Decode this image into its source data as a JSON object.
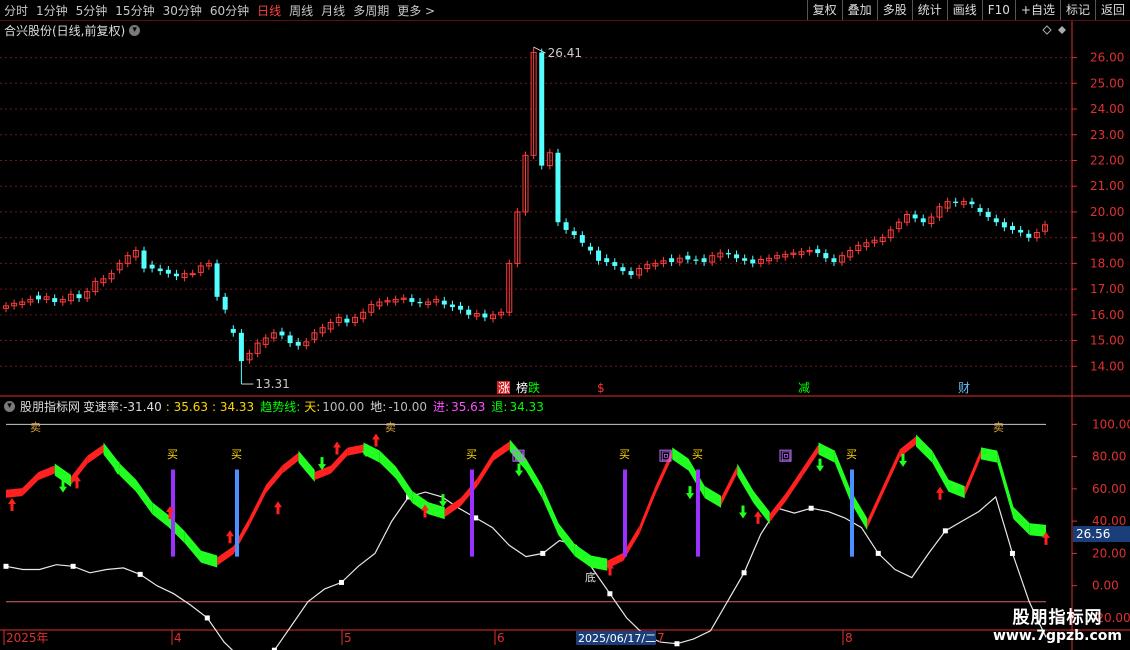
{
  "toolbar": {
    "periods": [
      "分时",
      "1分钟",
      "5分钟",
      "15分钟",
      "30分钟",
      "60分钟",
      "日线",
      "周线",
      "月线",
      "多周期"
    ],
    "active_period": "日线",
    "more": "更多",
    "right_buttons": [
      "复权",
      "叠加",
      "多股",
      "统计",
      "画线",
      "F10",
      "+自选",
      "标记",
      "返回"
    ]
  },
  "main_title": "合兴股份(日线,前复权)",
  "price_labels": {
    "high": "26.41",
    "low": "13.31"
  },
  "event_labels": [
    {
      "text": "涨",
      "color": "#ffffff",
      "bg": "#d02020"
    },
    {
      "text": "榜",
      "color": "#ffffff"
    },
    {
      "text": "跌",
      "color": "#00ff00"
    },
    {
      "text": "$",
      "color": "#ff3030"
    },
    {
      "text": "减",
      "color": "#00ff00"
    },
    {
      "text": "财",
      "color": "#60c0ff"
    }
  ],
  "indicator": {
    "name": "股朋指标网",
    "speed_label": "变速率:",
    "speed_value": "-31.40",
    "v2": ": 35.63",
    "v3": ": 34.33",
    "trend_label": "趋势线:",
    "sky_label": "天:",
    "sky_value": "100.00",
    "ground_label": "地:",
    "ground_value": "-10.00",
    "in_label": "进:",
    "in_value": "35.63",
    "out_label": "退:",
    "out_value": "34.33",
    "current_badge": "26.56"
  },
  "signal_labels": {
    "buy": "买",
    "sell": "卖",
    "return": "回",
    "bottom": "底"
  },
  "date_axis": {
    "labels": [
      "2025年",
      "4",
      "5",
      "6",
      "7",
      "8"
    ],
    "highlight": "2025/06/17/二"
  },
  "colors": {
    "up": "#ff3c3c",
    "down": "#54ffff",
    "grid": "#701818",
    "axis": "#e03030",
    "bull": "#ff2020",
    "bear": "#20ff20"
  },
  "watermark": {
    "line1": "股朋指标网",
    "line2": "www.7gpzb.com"
  },
  "chart_data": [
    {
      "type": "candlestick",
      "title": "合兴股份(日线,前复权)",
      "y_ticks": [
        14,
        15,
        16,
        17,
        18,
        19,
        20,
        21,
        22,
        23,
        24,
        25,
        26
      ],
      "ylim": [
        13.0,
        26.8
      ],
      "close": [
        16.35,
        16.45,
        16.5,
        16.6,
        16.6,
        16.7,
        16.5,
        16.6,
        16.8,
        16.65,
        16.9,
        17.3,
        17.4,
        17.6,
        18.0,
        18.3,
        18.5,
        17.8,
        17.8,
        17.7,
        17.6,
        17.5,
        17.6,
        17.6,
        17.9,
        18.0,
        16.7,
        16.2,
        15.3,
        14.2,
        14.5,
        14.9,
        15.1,
        15.3,
        15.2,
        14.9,
        14.8,
        14.95,
        15.3,
        15.5,
        15.7,
        15.9,
        15.7,
        15.9,
        16.1,
        16.4,
        16.5,
        16.55,
        16.6,
        16.65,
        16.5,
        16.45,
        16.5,
        16.6,
        16.4,
        16.3,
        16.2,
        16.0,
        16.05,
        15.9,
        16.0,
        16.1,
        18.0,
        20.0,
        22.2,
        26.2,
        21.8,
        22.3,
        19.6,
        19.3,
        19.1,
        18.8,
        18.5,
        18.1,
        18.05,
        17.9,
        17.7,
        17.55,
        17.8,
        17.95,
        18.0,
        18.1,
        18.05,
        18.2,
        18.15,
        18.1,
        18.05,
        18.3,
        18.4,
        18.35,
        18.2,
        18.1,
        18.0,
        18.15,
        18.2,
        18.3,
        18.35,
        18.4,
        18.45,
        18.5,
        18.4,
        18.2,
        18.05,
        18.3,
        18.5,
        18.7,
        18.8,
        18.9,
        19.0,
        19.3,
        19.6,
        19.9,
        19.75,
        19.6,
        19.8,
        20.2,
        20.4,
        20.35,
        20.4,
        20.3,
        20.0,
        19.8,
        19.6,
        19.4,
        19.3,
        19.2,
        19.0,
        19.2,
        19.5
      ],
      "x_axis_dates": [
        "2025年",
        "4",
        "5",
        "6",
        "7",
        "8"
      ]
    },
    {
      "type": "line",
      "title": "股朋指标网",
      "y_ticks": [
        -20,
        0,
        20,
        40,
        60,
        80,
        100
      ],
      "ylim": [
        -25,
        112
      ],
      "series": [
        {
          "name": "变速率",
          "values": [
            12,
            10,
            10,
            13,
            12,
            8,
            10,
            11,
            7,
            0,
            -5,
            -12,
            -20,
            -35,
            -45,
            -50,
            -40,
            -25,
            -10,
            -2,
            2,
            12,
            20,
            40,
            55,
            58,
            55,
            48,
            42,
            36,
            25,
            18,
            20,
            28,
            25,
            10,
            -5,
            -20,
            -30,
            -35,
            -36,
            -33,
            -28,
            -10,
            8,
            32,
            48,
            45,
            48,
            46,
            42,
            36,
            20,
            10,
            5,
            20,
            34,
            40,
            46,
            55,
            20,
            -10,
            -32
          ]
        },
        {
          "name": "趋势线",
          "values": [
            57,
            58,
            68,
            72,
            65,
            78,
            85,
            72,
            62,
            48,
            40,
            30,
            18,
            15,
            22,
            40,
            60,
            72,
            80,
            68,
            72,
            83,
            85,
            80,
            70,
            55,
            48,
            45,
            52,
            64,
            80,
            87,
            75,
            58,
            35,
            22,
            15,
            13,
            18,
            35,
            60,
            82,
            75,
            58,
            52,
            72,
            55,
            42,
            55,
            70,
            85,
            80,
            55,
            38,
            60,
            82,
            90,
            80,
            62,
            58,
            82,
            80,
            45,
            35,
            34
          ]
        }
      ],
      "reference_lines": [
        100,
        -10
      ]
    }
  ]
}
